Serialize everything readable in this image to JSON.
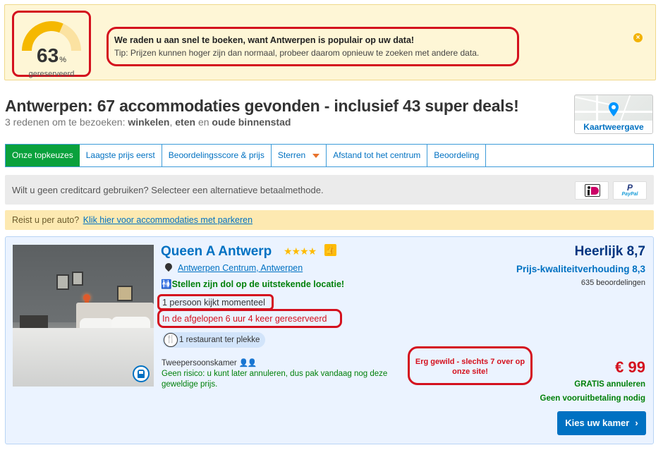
{
  "alert": {
    "gauge_percent": "63",
    "gauge_percent_sign": "%",
    "gauge_value": 0.63,
    "gauge_label": "gereserveerd",
    "title": "We raden u aan snel te boeken, want Antwerpen is populair op uw data!",
    "tip": "Tip: Prijzen kunnen hoger zijn dan normaal, probeer daarom opnieuw te zoeken met andere data.",
    "close_icon": "close-icon",
    "colors": {
      "gauge_fill": "#f5b800",
      "gauge_track": "#fbe2a1",
      "highlight": "#d4111e"
    }
  },
  "results": {
    "heading": "Antwerpen: 67 accommodaties gevonden - inclusief 43 super deals!",
    "sub_prefix": "3 redenen om te bezoeken: ",
    "reason1": "winkelen",
    "sep1": ", ",
    "reason2": "eten",
    "sep2": " en ",
    "reason3": "oude binnenstad"
  },
  "map": {
    "label": "Kaartweergave",
    "icon": "map-pin-icon"
  },
  "sort_tabs": [
    {
      "label": "Onze topkeuzes",
      "active": true
    },
    {
      "label": "Laagste prijs eerst"
    },
    {
      "label": "Beoordelingsscore & prijs"
    },
    {
      "label": "Sterren",
      "has_dropdown": true
    },
    {
      "label": "Afstand tot het centrum"
    },
    {
      "label": "Beoordeling"
    }
  ],
  "payment": {
    "text": "Wilt u geen creditcard gebruiken? Selecteer een alternatieve betaalmethode.",
    "paypal_label": "PayPal",
    "methods": [
      "ideal-icon",
      "paypal-icon"
    ]
  },
  "parking": {
    "text": "Reist u per auto?",
    "link": "Klik hier voor accommodaties met parkeren"
  },
  "property": {
    "name": "Queen A Antwerp",
    "stars": "★★★★",
    "thumb_icon": "thumbs-up-icon",
    "location": "Antwerpen Centrum, Antwerpen",
    "location_praise": "Stellen zijn dol op de uitstekende locatie!",
    "viewing_now": "1 persoon kijkt momenteel",
    "recently_booked": "In de afgelopen 6 uur 4 keer gereserveerd",
    "facility": "1 restaurant ter plekke",
    "room_type": "Tweepersoonskamer",
    "risk_free": "Geen risico: u kunt later annuleren, dus pak vandaag nog deze geweldige prijs.",
    "popular_note": "Erg gewild - slechts 7 over op onze site!",
    "score_word": "Heerlijk 8,7",
    "value_score": "Prijs-kwaliteitverhouding 8,3",
    "reviews": "635 beoordelingen",
    "price": "€ 99",
    "free_cancel": "GRATIS annuleren",
    "no_prepayment": "Geen vooruitbetaling nodig",
    "cta_label": "Kies uw kamer",
    "cta_chevron": "›"
  }
}
